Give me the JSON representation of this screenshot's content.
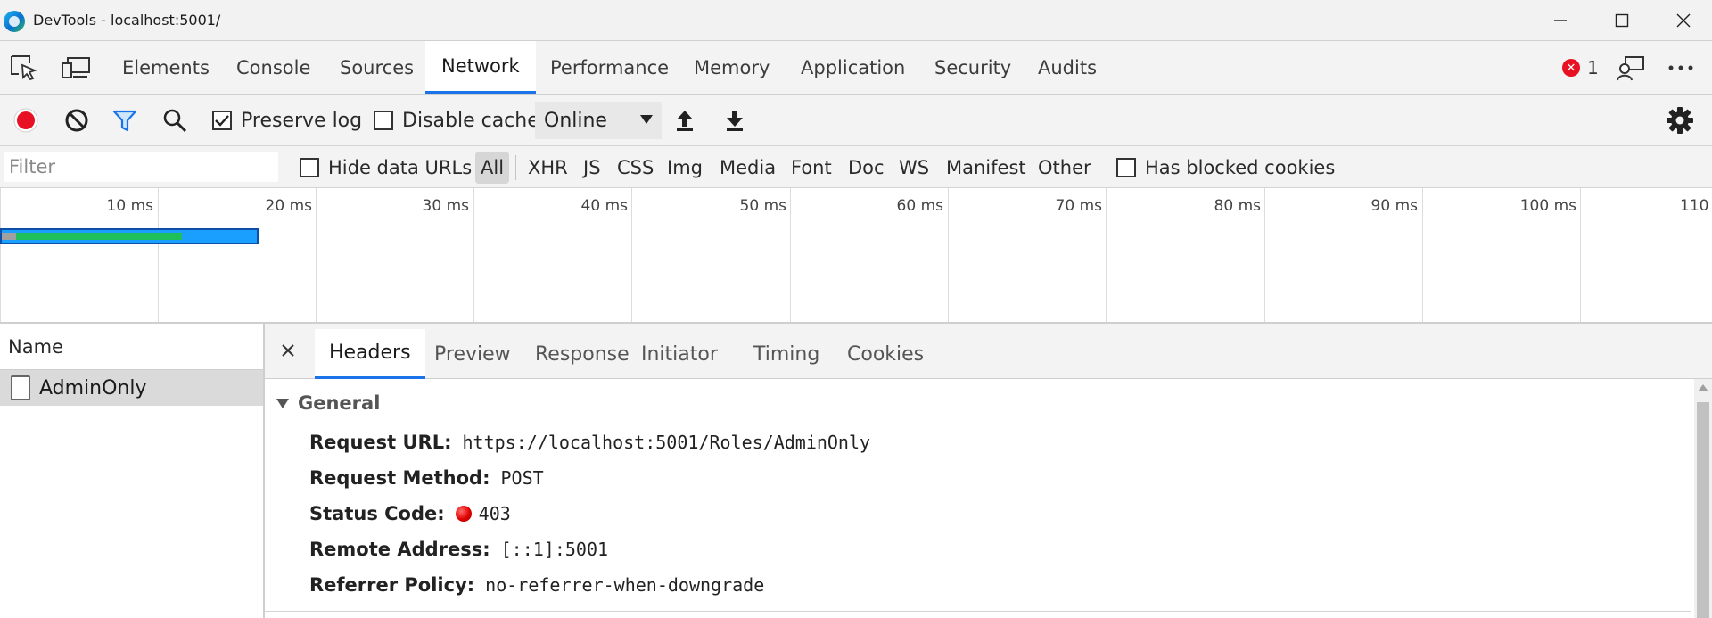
{
  "window": {
    "title": "DevTools - localhost:5001/"
  },
  "main_tabs": [
    "Elements",
    "Console",
    "Sources",
    "Network",
    "Performance",
    "Memory",
    "Application",
    "Security",
    "Audits"
  ],
  "active_main_tab": "Network",
  "error_count": "1",
  "network_toolbar": {
    "preserve_log": {
      "label": "Preserve log",
      "checked": true
    },
    "disable_cache": {
      "label": "Disable cache",
      "checked": false
    },
    "throttling": "Online"
  },
  "filter_bar": {
    "placeholder": "Filter",
    "hide_data_urls": "Hide data URLs",
    "types": [
      "All",
      "XHR",
      "JS",
      "CSS",
      "Img",
      "Media",
      "Font",
      "Doc",
      "WS",
      "Manifest",
      "Other"
    ],
    "active_type": "All",
    "has_blocked_cookies": "Has blocked cookies"
  },
  "timeline": {
    "ticks": [
      "10 ms",
      "20 ms",
      "30 ms",
      "40 ms",
      "50 ms",
      "60 ms",
      "70 ms",
      "80 ms",
      "90 ms",
      "100 ms",
      "110"
    ],
    "colors": {
      "waiting": "#1a9fff",
      "download": "#1fbf5a",
      "queued": "#a0a0a0"
    }
  },
  "request_list": {
    "header": "Name",
    "rows": [
      {
        "name": "AdminOnly",
        "selected": true
      }
    ]
  },
  "detail": {
    "tabs": [
      "Headers",
      "Preview",
      "Response",
      "Initiator",
      "Timing",
      "Cookies"
    ],
    "active_tab": "Headers",
    "general": {
      "title": "General",
      "request_url": {
        "label": "Request URL:",
        "value": "https://localhost:5001/Roles/AdminOnly"
      },
      "request_method": {
        "label": "Request Method:",
        "value": "POST"
      },
      "status_code": {
        "label": "Status Code:",
        "value": "403"
      },
      "remote_address": {
        "label": "Remote Address:",
        "value": "[::1]:5001"
      },
      "referrer_policy": {
        "label": "Referrer Policy:",
        "value": "no-referrer-when-downgrade"
      }
    }
  }
}
